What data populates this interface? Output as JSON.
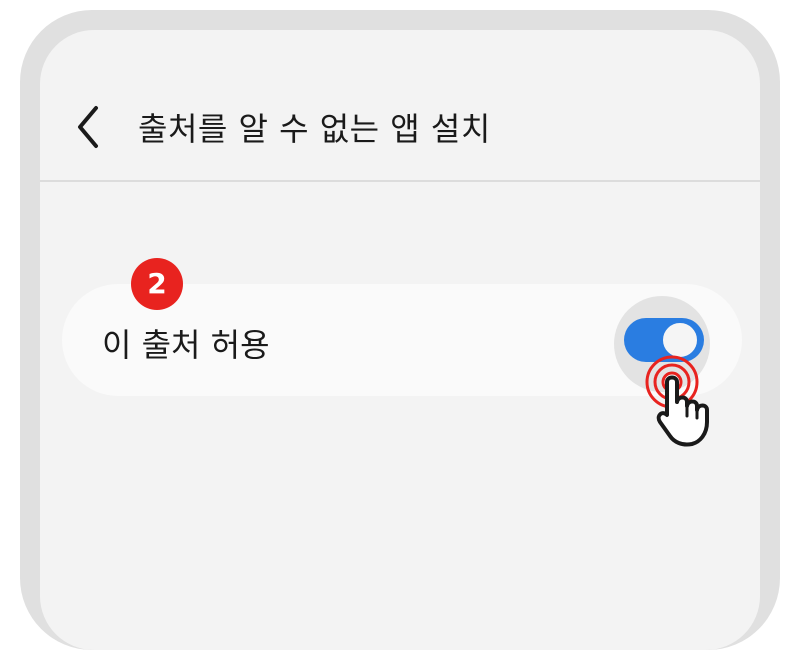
{
  "header": {
    "title": "출처를 알 수 없는 앱 설치",
    "back_icon": "chevron-left-icon"
  },
  "setting": {
    "label": "이 출처 허용",
    "toggle_state": "on"
  },
  "annotation": {
    "step_number": "2",
    "cursor_icon": "pointing-hand-tap-icon"
  },
  "colors": {
    "frame": "#e0e0e0",
    "screen_bg": "#f3f3f3",
    "row_bg": "#fafafa",
    "toggle_on": "#2a7de1",
    "badge_red": "#e8231f"
  }
}
